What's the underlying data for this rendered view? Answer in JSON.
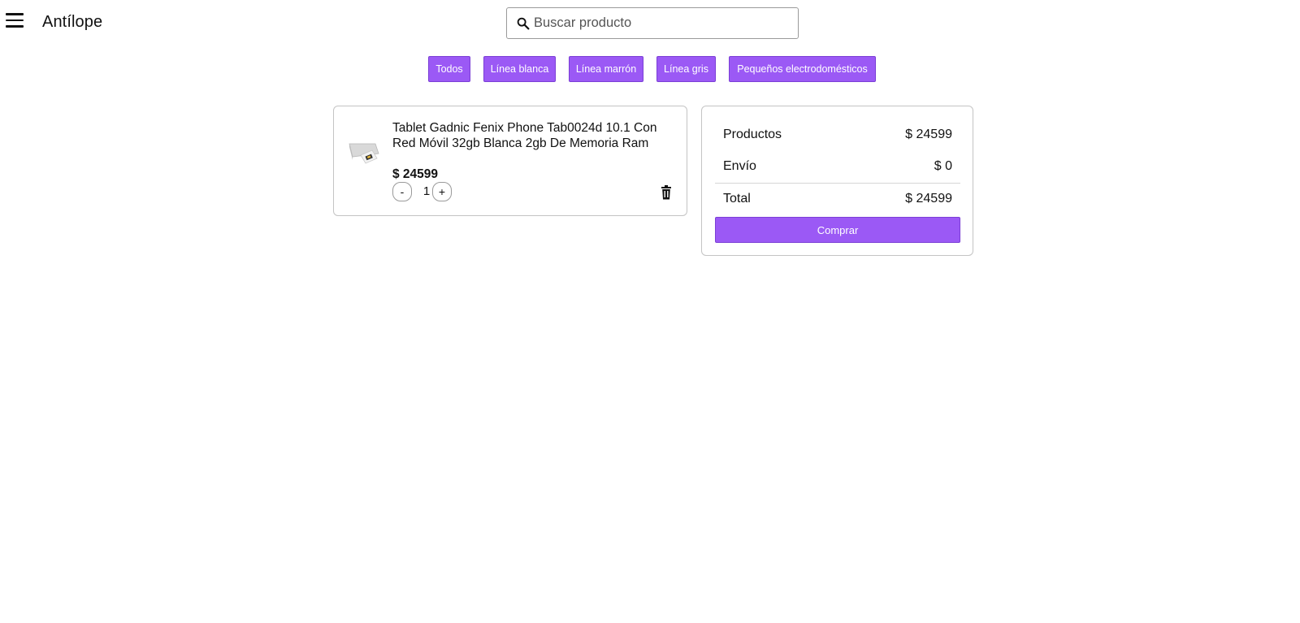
{
  "header": {
    "brand": "Antílope",
    "search_placeholder": "Buscar producto"
  },
  "categories": [
    {
      "label": "Todos"
    },
    {
      "label": "Línea blanca"
    },
    {
      "label": "Línea marrón"
    },
    {
      "label": "Línea gris"
    },
    {
      "label": "Pequeños electrodomésticos"
    }
  ],
  "cart": {
    "items": [
      {
        "title": "Tablet Gadnic Fenix Phone Tab0024d 10.1 Con Red Móvil 32gb Blanca 2gb De Memoria Ram",
        "price": "$ 24599",
        "quantity": "1",
        "decrement_label": "-",
        "increment_label": "+"
      }
    ]
  },
  "summary": {
    "products_label": "Productos",
    "products_value": "$ 24599",
    "shipping_label": "Envío",
    "shipping_value": "$ 0",
    "total_label": "Total",
    "total_value": "$ 24599",
    "buy_label": "Comprar"
  },
  "colors": {
    "accent": "#9b59f5"
  }
}
